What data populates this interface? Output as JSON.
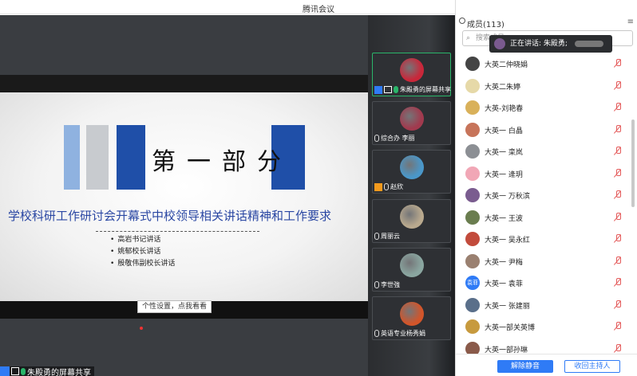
{
  "window": {
    "title": "腾讯会议",
    "controls": [
      "—",
      "❐",
      "✕"
    ]
  },
  "share": {
    "slide_title": "第一部分",
    "slide_subtitle": "学校科研工作研讨会开幕式中校领导相关讲话精神和工作要求",
    "bullets": [
      "高岩书记讲话",
      "姚郁校长讲话",
      "殷敬伟副校长讲话"
    ],
    "bar_colors": [
      "#8fb2e0",
      "#c8cbcf",
      "#1f4fa8",
      "#1f4fa8"
    ],
    "tooltip": "个性设置，点我看看",
    "sharer_label": "朱殿勇的屏幕共享"
  },
  "gallery": {
    "tiles": [
      {
        "label": "朱殿勇的屏幕共享",
        "icon": "screen-share",
        "active": true,
        "avatar_color": "#c9273a"
      },
      {
        "label": "综合办 李丽",
        "icon": "mic-muted",
        "active": false,
        "avatar_color": "#a13a4e"
      },
      {
        "label": "赵欣",
        "icon": "camera-off",
        "active": false,
        "avatar_color": "#4a97c9"
      },
      {
        "label": "周丽云",
        "icon": "mic-muted",
        "active": false,
        "avatar_color": "#b9a98e"
      },
      {
        "label": "李世強",
        "icon": "mic-muted",
        "active": false,
        "avatar_color": "#8aa6a0"
      },
      {
        "label": "英语专业杨秀娟",
        "icon": "mic-muted",
        "active": false,
        "avatar_color": "#d2552a"
      }
    ]
  },
  "panel": {
    "title": "成员(113)",
    "search_placeholder": "搜索成员",
    "speaking_text": "正在讲话: 朱殿勇;",
    "members": [
      {
        "name": "大英二仲晓娟",
        "avatar_color": "#444444",
        "avatar_text": ""
      },
      {
        "name": "大英二朱婷",
        "avatar_color": "#e6d9a8",
        "avatar_text": ""
      },
      {
        "name": "大英-刘艳春",
        "avatar_color": "#d9b15a",
        "avatar_text": ""
      },
      {
        "name": "大英一 白晶",
        "avatar_color": "#c7745a",
        "avatar_text": ""
      },
      {
        "name": "大英一 栾岚",
        "avatar_color": "#8c8f94",
        "avatar_text": ""
      },
      {
        "name": "大英一 逄玥",
        "avatar_color": "#f1a7b6",
        "avatar_text": ""
      },
      {
        "name": "大英一 万秋滨",
        "avatar_color": "#7a5c8f",
        "avatar_text": ""
      },
      {
        "name": "大英一 王波",
        "avatar_color": "#6a7d4f",
        "avatar_text": ""
      },
      {
        "name": "大英一 吴永红",
        "avatar_color": "#c24b3c",
        "avatar_text": ""
      },
      {
        "name": "大英一 尹梅",
        "avatar_color": "#9a8070",
        "avatar_text": ""
      },
      {
        "name": "大英一 袁菲",
        "avatar_color": "#2f7bf6",
        "avatar_text": "袁菲"
      },
      {
        "name": "大英一 张建丽",
        "avatar_color": "#5a6f8a",
        "avatar_text": ""
      },
      {
        "name": "大英一部关英博",
        "avatar_color": "#c79a3e",
        "avatar_text": ""
      },
      {
        "name": "大英一部孙琳",
        "avatar_color": "#8a5a4a",
        "avatar_text": ""
      }
    ],
    "unmute_all": "解除静音",
    "reclaim_host": "收回主持人"
  }
}
